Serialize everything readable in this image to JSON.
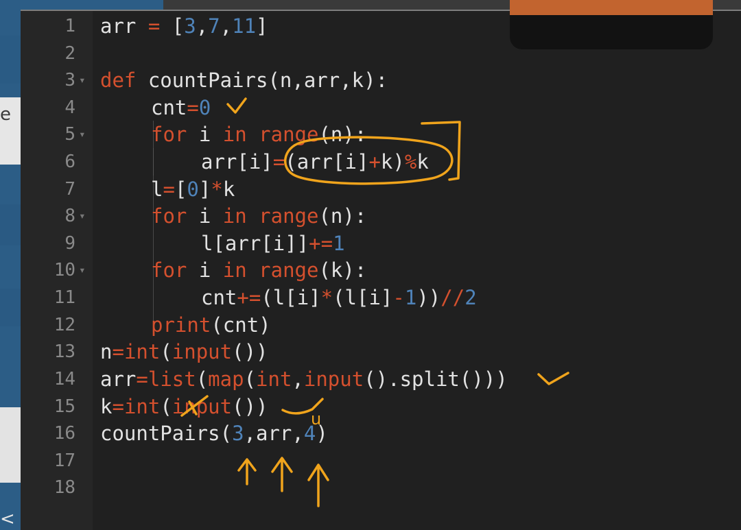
{
  "line_numbers": [
    "1",
    "2",
    "3",
    "4",
    "5",
    "6",
    "7",
    "8",
    "9",
    "10",
    "11",
    "12",
    "13",
    "14",
    "15",
    "16",
    "17",
    "18"
  ],
  "code": {
    "l1": {
      "a": "arr ",
      "b": "=",
      "c": " [",
      "d": "3",
      ",": ",",
      "e": "7",
      "f": ",",
      "g": "11",
      "h": "]"
    },
    "l3": {
      "a": "def",
      "b": " countPairs(n,arr,k):"
    },
    "l4": {
      "a": "cnt",
      "b": "=",
      "c": "0"
    },
    "l5": {
      "a": "for",
      "b": " i ",
      "c": "in",
      "d": " range",
      "e": "(n):"
    },
    "l6": {
      "a": "arr[i]",
      "b": "=",
      "c": "(arr[i]",
      "d": "+",
      "e": "k)",
      "f": "%",
      "g": "k"
    },
    "l7": {
      "a": "l",
      "b": "=",
      "c": "[",
      "d": "0",
      "e": "]",
      "f": "*",
      "g": "k"
    },
    "l8": {
      "a": "for",
      "b": " i ",
      "c": "in",
      "d": " range",
      "e": "(n):"
    },
    "l9": {
      "a": "l[arr[i]]",
      "b": "+=",
      "c": "1"
    },
    "l10": {
      "a": "for",
      "b": " i ",
      "c": "in",
      "d": " range",
      "e": "(k):"
    },
    "l11": {
      "a": "cnt",
      "b": "+=",
      "c": "(l[i]",
      "d": "*",
      "e": "(l[i]",
      "f": "-",
      "g": "1",
      "h": "))",
      "i": "//",
      "j": "2"
    },
    "l12": {
      "a": "print",
      "b": "(cnt)"
    },
    "l13": {
      "a": "n",
      "b": "=",
      "c": "int",
      "d": "(",
      "e": "input",
      "f": "())"
    },
    "l14": {
      "a": "arr",
      "b": "=",
      "c": "list",
      "d": "(",
      "e": "map",
      "f": "(",
      "g": "int",
      ",": ",",
      "h": "input",
      "i": "().split()))"
    },
    "l15": {
      "a": "k",
      "b": "=",
      "c": "int",
      "d": "(",
      "e": "input",
      "f": "())"
    },
    "l16": {
      "a": "countPairs(",
      "b": "3",
      "c": ",arr,",
      "d": "4",
      "e": ")"
    }
  },
  "annotation_letter": "u",
  "colors": {
    "keyword": "#d4502e",
    "number": "#4f83b9",
    "text": "#e2e2e2",
    "ink": "#f0a41c",
    "accent_bar": "#c2642f"
  },
  "left_panel": {
    "partial_letter": "e",
    "back_glyph": "<"
  }
}
